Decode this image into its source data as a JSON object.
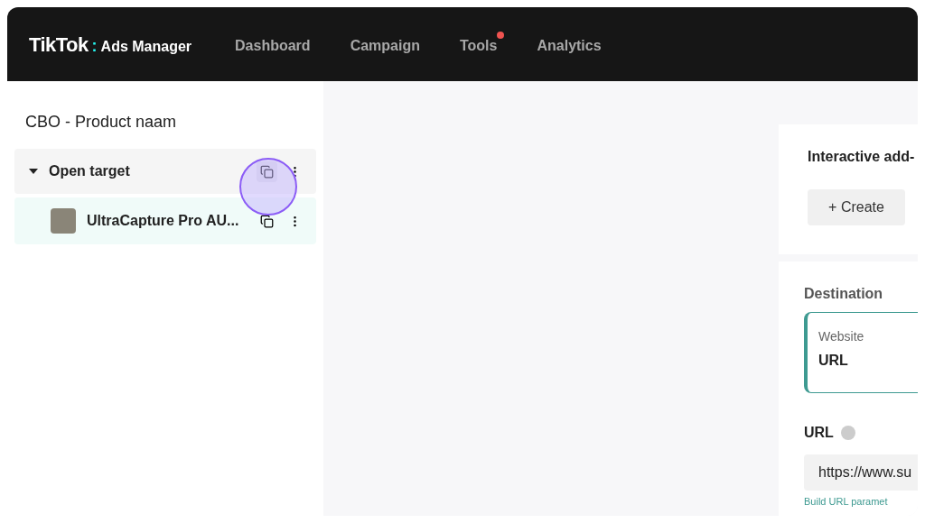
{
  "header": {
    "logo": {
      "brand": "TikTok",
      "separator": ":",
      "product": "Ads Manager"
    },
    "nav": [
      {
        "label": "Dashboard",
        "dot": false
      },
      {
        "label": "Campaign",
        "dot": false
      },
      {
        "label": "Tools",
        "dot": true
      },
      {
        "label": "Analytics",
        "dot": false
      }
    ]
  },
  "sidebar": {
    "title": "CBO - Product naam",
    "tree": [
      {
        "label": "Open target",
        "expanded": true,
        "selected": false,
        "children": [
          {
            "label": "UltraCapture Pro AU...",
            "selected": true
          }
        ]
      }
    ]
  },
  "right_panel": {
    "addons": {
      "title": "Interactive add-",
      "button": "+ Create"
    },
    "destination": {
      "title": "Destination",
      "option": {
        "label": "Website",
        "value": "URL",
        "selected": true
      }
    },
    "url": {
      "label": "URL",
      "value": "https://www.su",
      "link": "Build URL paramet"
    }
  }
}
